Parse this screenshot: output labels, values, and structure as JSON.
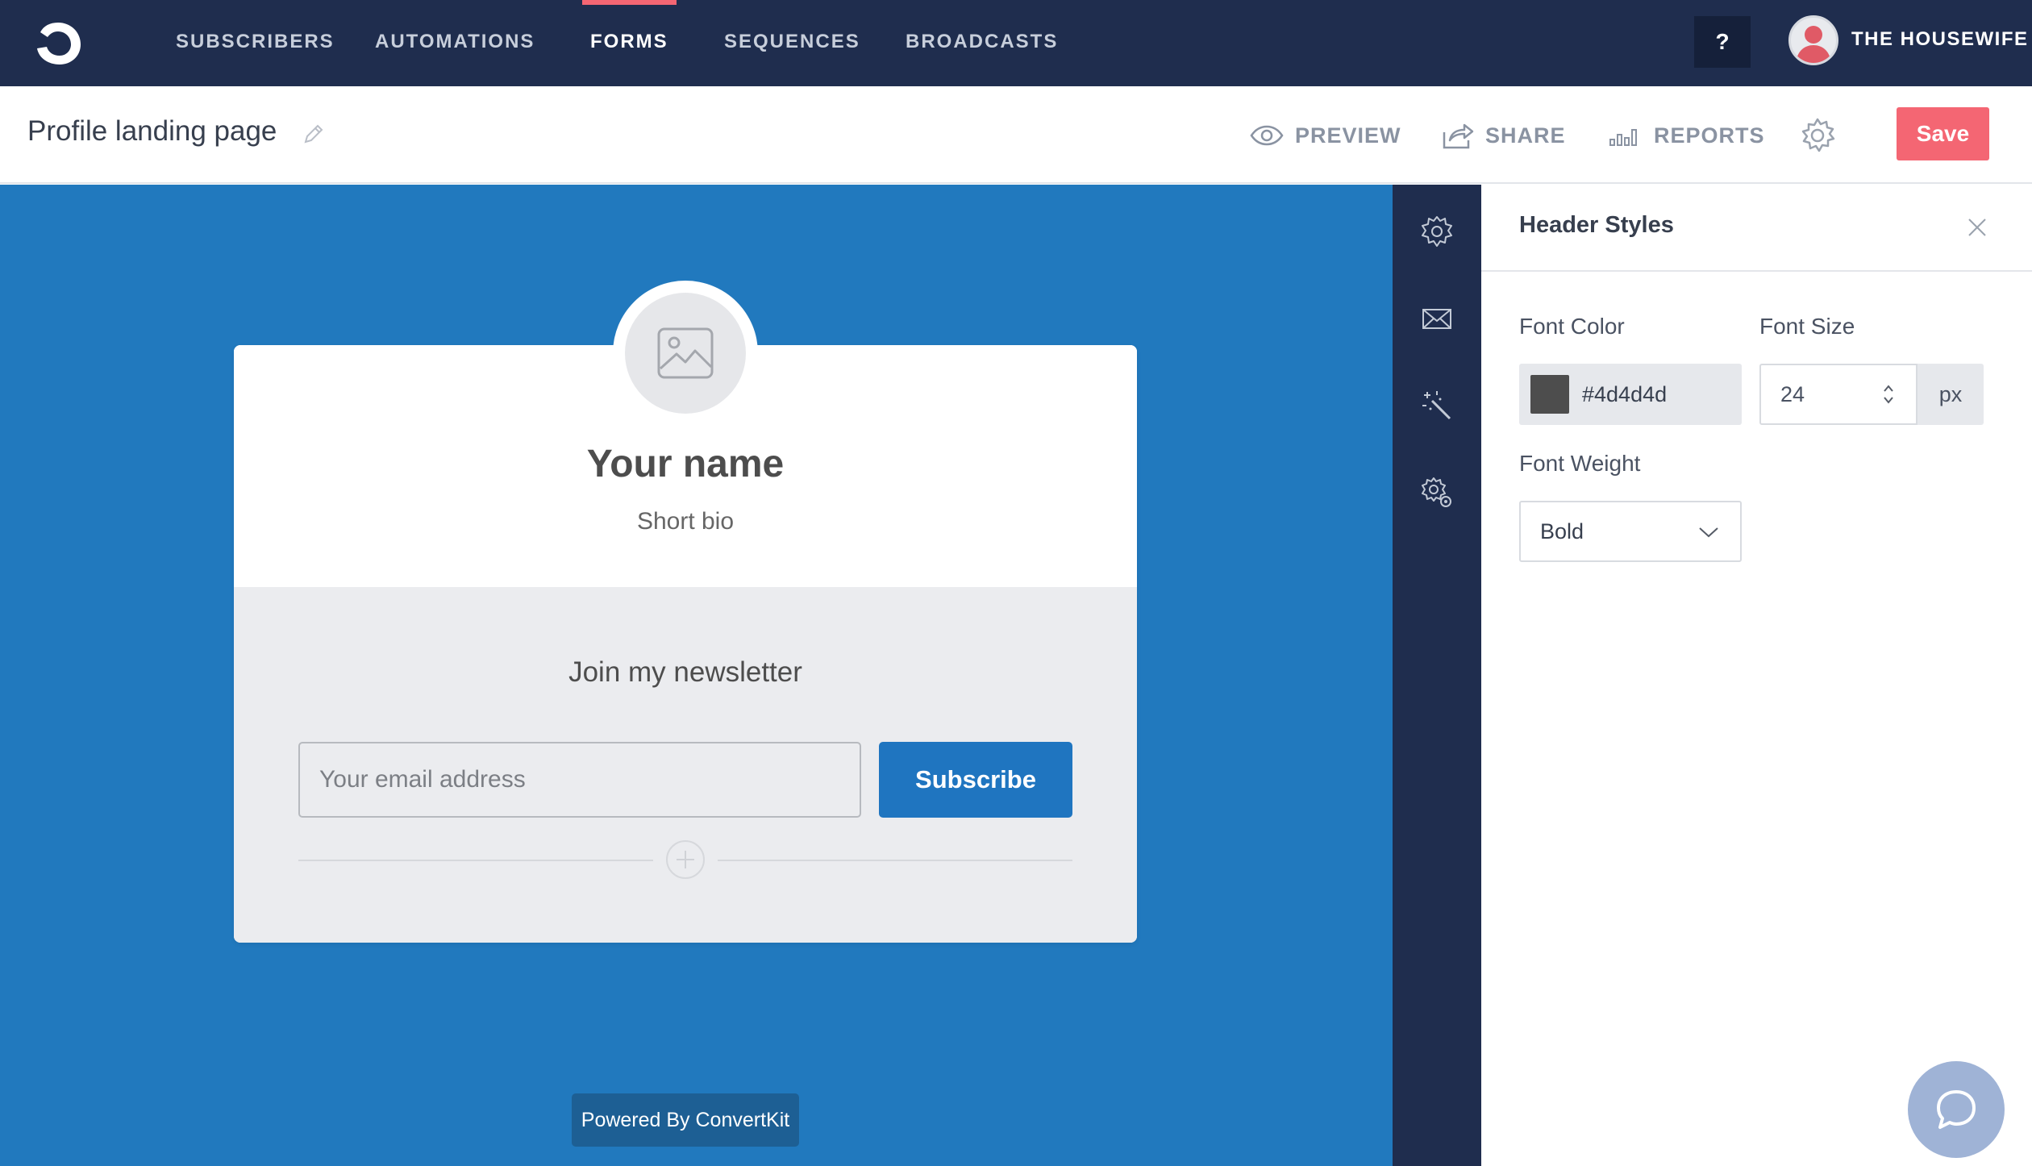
{
  "nav": {
    "items": [
      {
        "label": "SUBSCRIBERS"
      },
      {
        "label": "AUTOMATIONS"
      },
      {
        "label": "FORMS"
      },
      {
        "label": "SEQUENCES"
      },
      {
        "label": "BROADCASTS"
      }
    ],
    "active": "FORMS",
    "help_label": "?",
    "account_name": "THE HOUSEWIFE M"
  },
  "header": {
    "title": "Profile landing page",
    "actions": {
      "preview": "PREVIEW",
      "share": "SHARE",
      "reports": "REPORTS"
    },
    "save_label": "Save"
  },
  "canvas": {
    "name": "Your name",
    "bio": "Short bio",
    "newsletter_heading": "Join my newsletter",
    "email_placeholder": "Your email address",
    "subscribe_label": "Subscribe",
    "powered_by": "Powered By ConvertKit",
    "background_color": "#2179be"
  },
  "rail": {
    "icons": [
      "gear-icon",
      "envelope-icon",
      "magic-wand-icon",
      "advanced-settings-icon"
    ]
  },
  "panel": {
    "title": "Header Styles",
    "font_color_label": "Font Color",
    "font_color_value": "#4d4d4d",
    "font_size_label": "Font Size",
    "font_size_value": "24",
    "font_size_unit": "px",
    "font_weight_label": "Font Weight",
    "font_weight_value": "Bold"
  },
  "colors": {
    "nav_bg": "#1f2d4e",
    "accent": "#f46673",
    "button_blue": "#1f75c0"
  }
}
